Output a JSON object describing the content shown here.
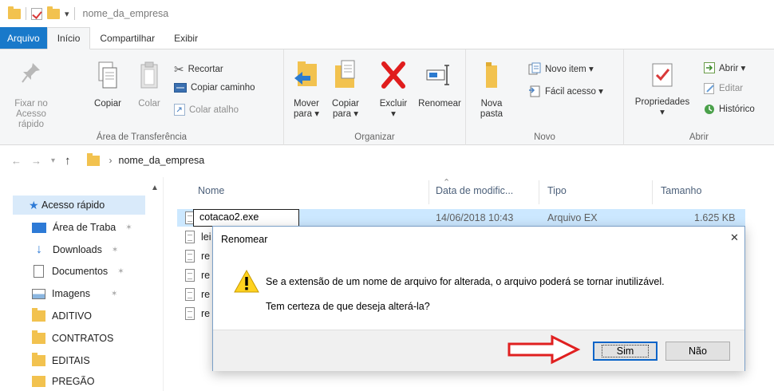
{
  "window": {
    "title": "nome_da_empresa"
  },
  "tabs": [
    "Arquivo",
    "Início",
    "Compartilhar",
    "Exibir"
  ],
  "ribbon": {
    "clipboard": {
      "label": "Área de Transferência",
      "pin": "Fixar no\nAcesso rápido",
      "pin_l1": "Fixar no",
      "pin_l2": "Acesso rápido",
      "copy": "Copiar",
      "paste": "Colar",
      "cut": "Recortar",
      "copy_path": "Copiar caminho",
      "paste_shortcut": "Colar atalho"
    },
    "organize": {
      "label": "Organizar",
      "move_l1": "Mover",
      "move_l2": "para ▾",
      "copy_l1": "Copiar",
      "copy_l2": "para ▾",
      "delete": "Excluir",
      "delete_arrow": "▾",
      "rename": "Renomear"
    },
    "new": {
      "label": "Novo",
      "folder_l1": "Nova",
      "folder_l2": "pasta",
      "new_item": "Novo item ▾",
      "easy_access": "Fácil acesso ▾"
    },
    "open": {
      "label": "Abrir",
      "properties": "Propriedades",
      "properties_arrow": "▾",
      "open": "Abrir ▾",
      "edit": "Editar",
      "history": "Histórico"
    }
  },
  "address": {
    "path": "nome_da_empresa"
  },
  "nav": {
    "items": [
      {
        "label": "Acesso rápido",
        "icon": "star-icon"
      },
      {
        "label": "Área de Traba",
        "icon": "desktop-icon",
        "pinned": true
      },
      {
        "label": "Downloads",
        "icon": "download-icon",
        "pinned": true
      },
      {
        "label": "Documentos",
        "icon": "documents-icon",
        "pinned": true
      },
      {
        "label": "Imagens",
        "icon": "images-icon",
        "pinned": true
      },
      {
        "label": "ADITIVO",
        "icon": "folder-icon"
      },
      {
        "label": "CONTRATOS",
        "icon": "folder-icon"
      },
      {
        "label": "EDITAIS",
        "icon": "folder-icon"
      },
      {
        "label": "PREGÃO",
        "icon": "folder-icon"
      }
    ],
    "pin_glyph": "✶"
  },
  "list": {
    "columns": [
      "Nome",
      "Data de modific...",
      "Tipo",
      "Tamanho"
    ],
    "selected_row": {
      "name": "cotacao2.exe",
      "date": "14/06/2018 10:43",
      "type": "Arquivo EX",
      "size": "1.625 KB"
    },
    "other_rows": [
      "lei",
      "re",
      "re",
      "re",
      "re"
    ]
  },
  "dialog": {
    "title": "Renomear",
    "message": "Se a extensão de um nome de arquivo for alterada, o arquivo poderá se tornar inutilizável.",
    "question": "Tem certeza de que deseja alterá-la?",
    "yes": "Sim",
    "no": "Não"
  },
  "colors": {
    "file_tab": "#1979ca",
    "selection": "#cce8ff",
    "arrow": "#e02020"
  }
}
